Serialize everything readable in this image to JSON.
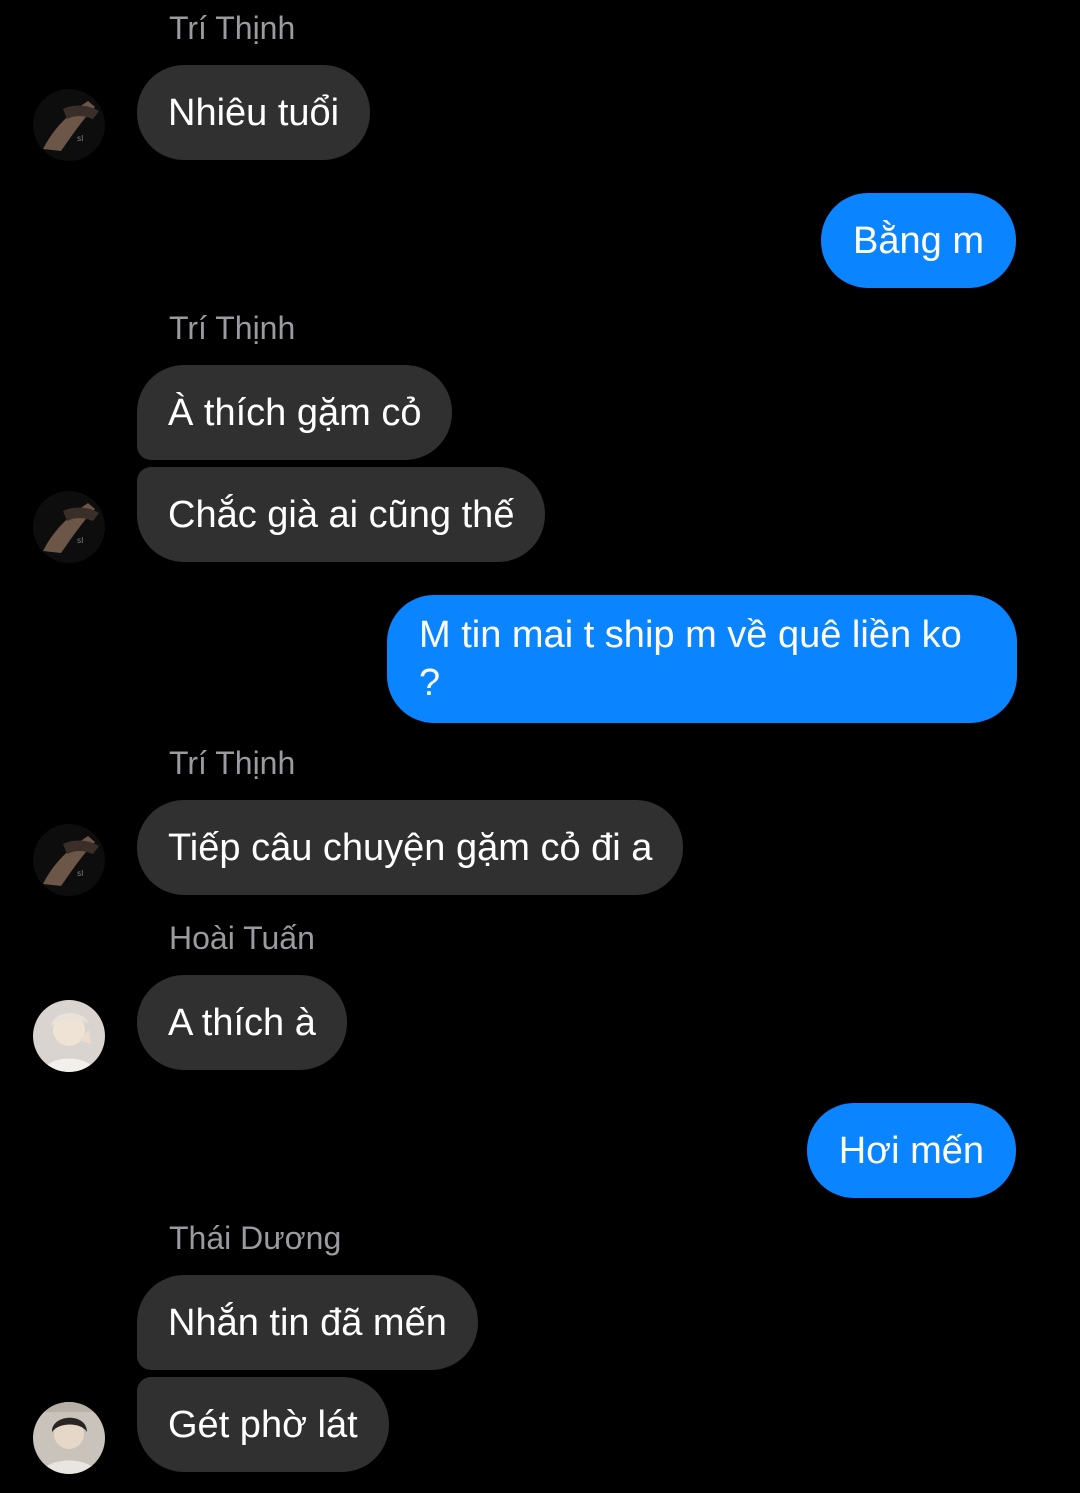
{
  "messages": {
    "m1_sender": "Trí Thịnh",
    "m1_text": "Nhiêu tuổi",
    "m2_text": "Bằng m",
    "m3_sender": "Trí Thịnh",
    "m3a_text": "À thích gặm cỏ",
    "m3b_text": "Chắc già ai cũng thế",
    "m4_text": "M tin mai t ship m về quê liền ko ?",
    "m5_sender": "Trí Thịnh",
    "m5_text": "Tiếp câu chuyện gặm cỏ đi a",
    "m6_sender": "Hoài Tuấn",
    "m6_text": "A thích à",
    "m7_text": "Hơi mến",
    "m8_sender": "Thái Dương",
    "m8a_text": "Nhắn tin đã mến",
    "m8b_text": "Gét phờ lát"
  },
  "avatars": {
    "tri_thinh": "avatar-tri-thinh",
    "hoai_tuan": "avatar-hoai-tuan",
    "thai_duong": "avatar-thai-duong"
  },
  "colors": {
    "background": "#000000",
    "incoming_bubble": "#303030",
    "outgoing_bubble": "#0a84ff",
    "sender_name": "#9a9a9f"
  }
}
